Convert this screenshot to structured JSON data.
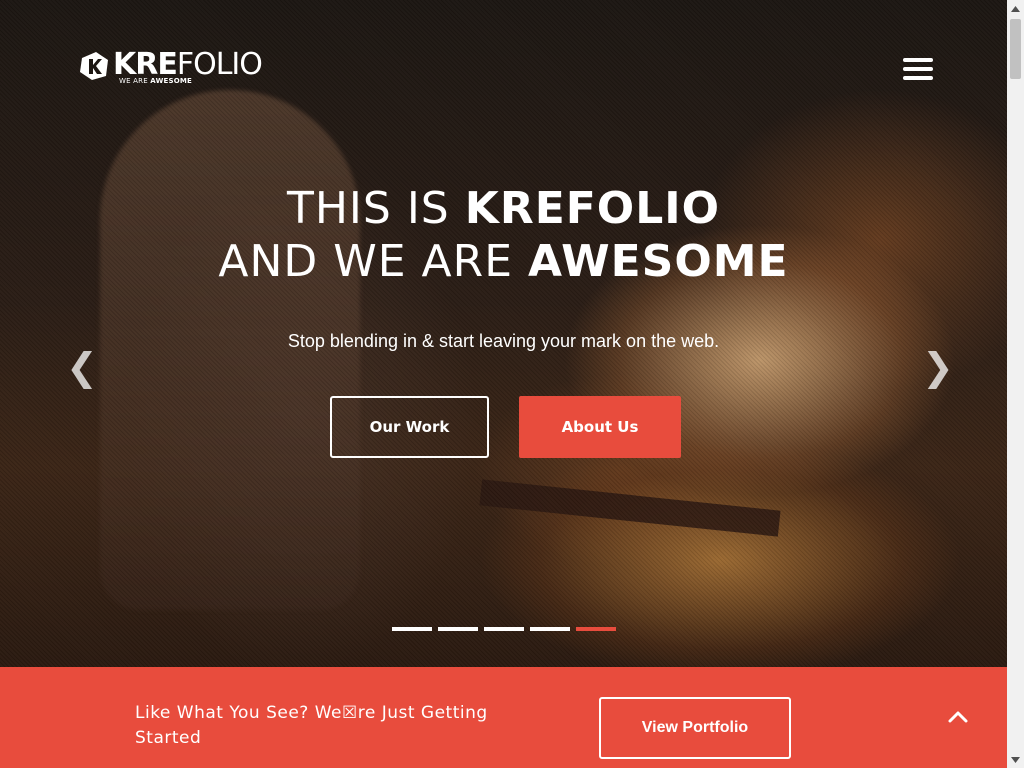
{
  "brand": {
    "name_bold": "KRE",
    "name_light": "FOLIO",
    "tagline_light": "WE ARE ",
    "tagline_bold": "AWESOME"
  },
  "hero": {
    "line1_light": "THIS IS ",
    "line1_bold": "KREFOLIO",
    "line2_light": "AND WE ARE ",
    "line2_bold": "AWESOME",
    "subtitle": "Stop blending in & start leaving your mark on the web.",
    "prev_arrow": "❮",
    "next_arrow": "❯",
    "buttons": {
      "our_work": "Our Work",
      "about_us": "About Us"
    },
    "slides": {
      "count": 5,
      "active_index": 4
    }
  },
  "cta": {
    "text": "Like What You See? We\u0000re Just Getting Started",
    "text_display": "Like What You See? We☒re Just Getting Started",
    "button": "View Portfolio"
  },
  "colors": {
    "accent": "#e84c3d",
    "text": "#ffffff"
  },
  "icons": {
    "menu": "hamburger-icon",
    "back_to_top": "chevron-up-icon",
    "logo": "krefolio-logo-icon"
  }
}
